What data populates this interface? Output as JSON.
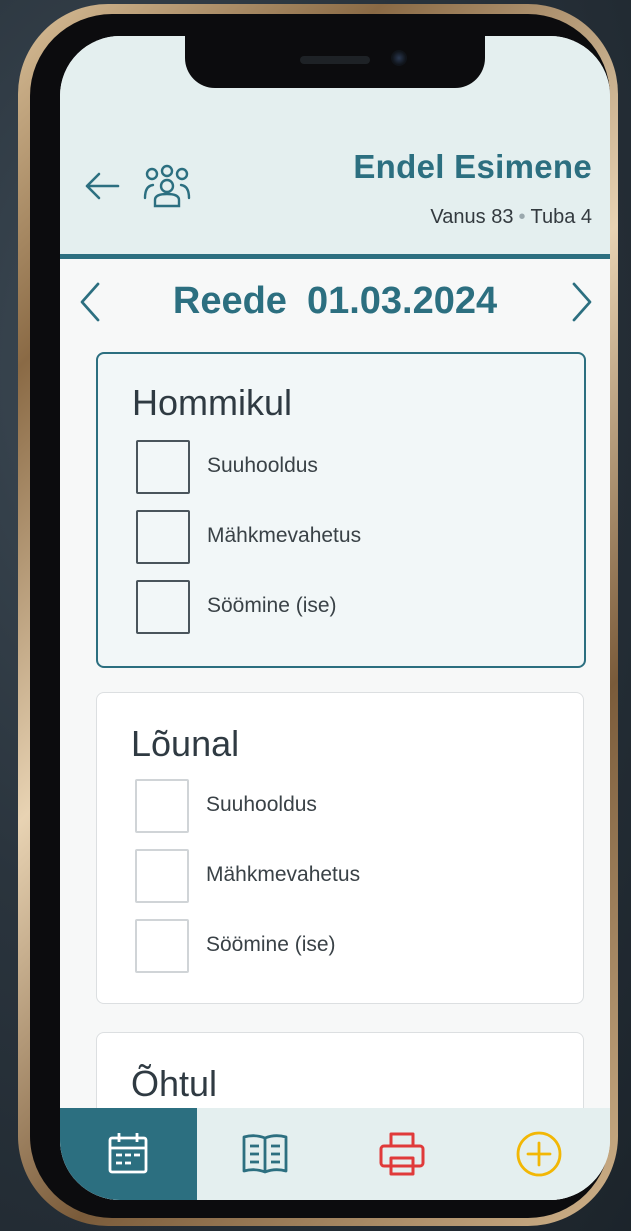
{
  "header": {
    "patient_name": "Endel Esimene",
    "age_label": "Vanus 83",
    "separator": "•",
    "room_label": "Tuba 4",
    "back_icon": "arrow-left-icon",
    "group_icon": "users-group-icon"
  },
  "date_nav": {
    "day": "Reede",
    "date": "01.03.2024",
    "prev_icon": "chevron-left-icon",
    "next_icon": "chevron-right-icon"
  },
  "sections": [
    {
      "title": "Hommikul",
      "active": true,
      "tasks": [
        {
          "label": "Suuhooldus",
          "checked": false
        },
        {
          "label": "Mähkmevahetus",
          "checked": false
        },
        {
          "label": "Söömine (ise)",
          "checked": false
        }
      ]
    },
    {
      "title": "Lõunal",
      "active": false,
      "tasks": [
        {
          "label": "Suuhooldus",
          "checked": false
        },
        {
          "label": "Mähkmevahetus",
          "checked": false
        },
        {
          "label": "Söömine (ise)",
          "checked": false
        }
      ]
    },
    {
      "title": "Õhtul",
      "active": false,
      "tasks": []
    }
  ],
  "tabbar": {
    "tabs": [
      {
        "icon": "calendar-icon",
        "active": true
      },
      {
        "icon": "book-icon",
        "active": false
      },
      {
        "icon": "printer-icon",
        "active": false
      },
      {
        "icon": "add-circle-icon",
        "active": false
      }
    ]
  },
  "colors": {
    "accent": "#2c6f80",
    "header_bg": "#e4efef",
    "printer": "#e03a3a",
    "add": "#f2b705"
  }
}
